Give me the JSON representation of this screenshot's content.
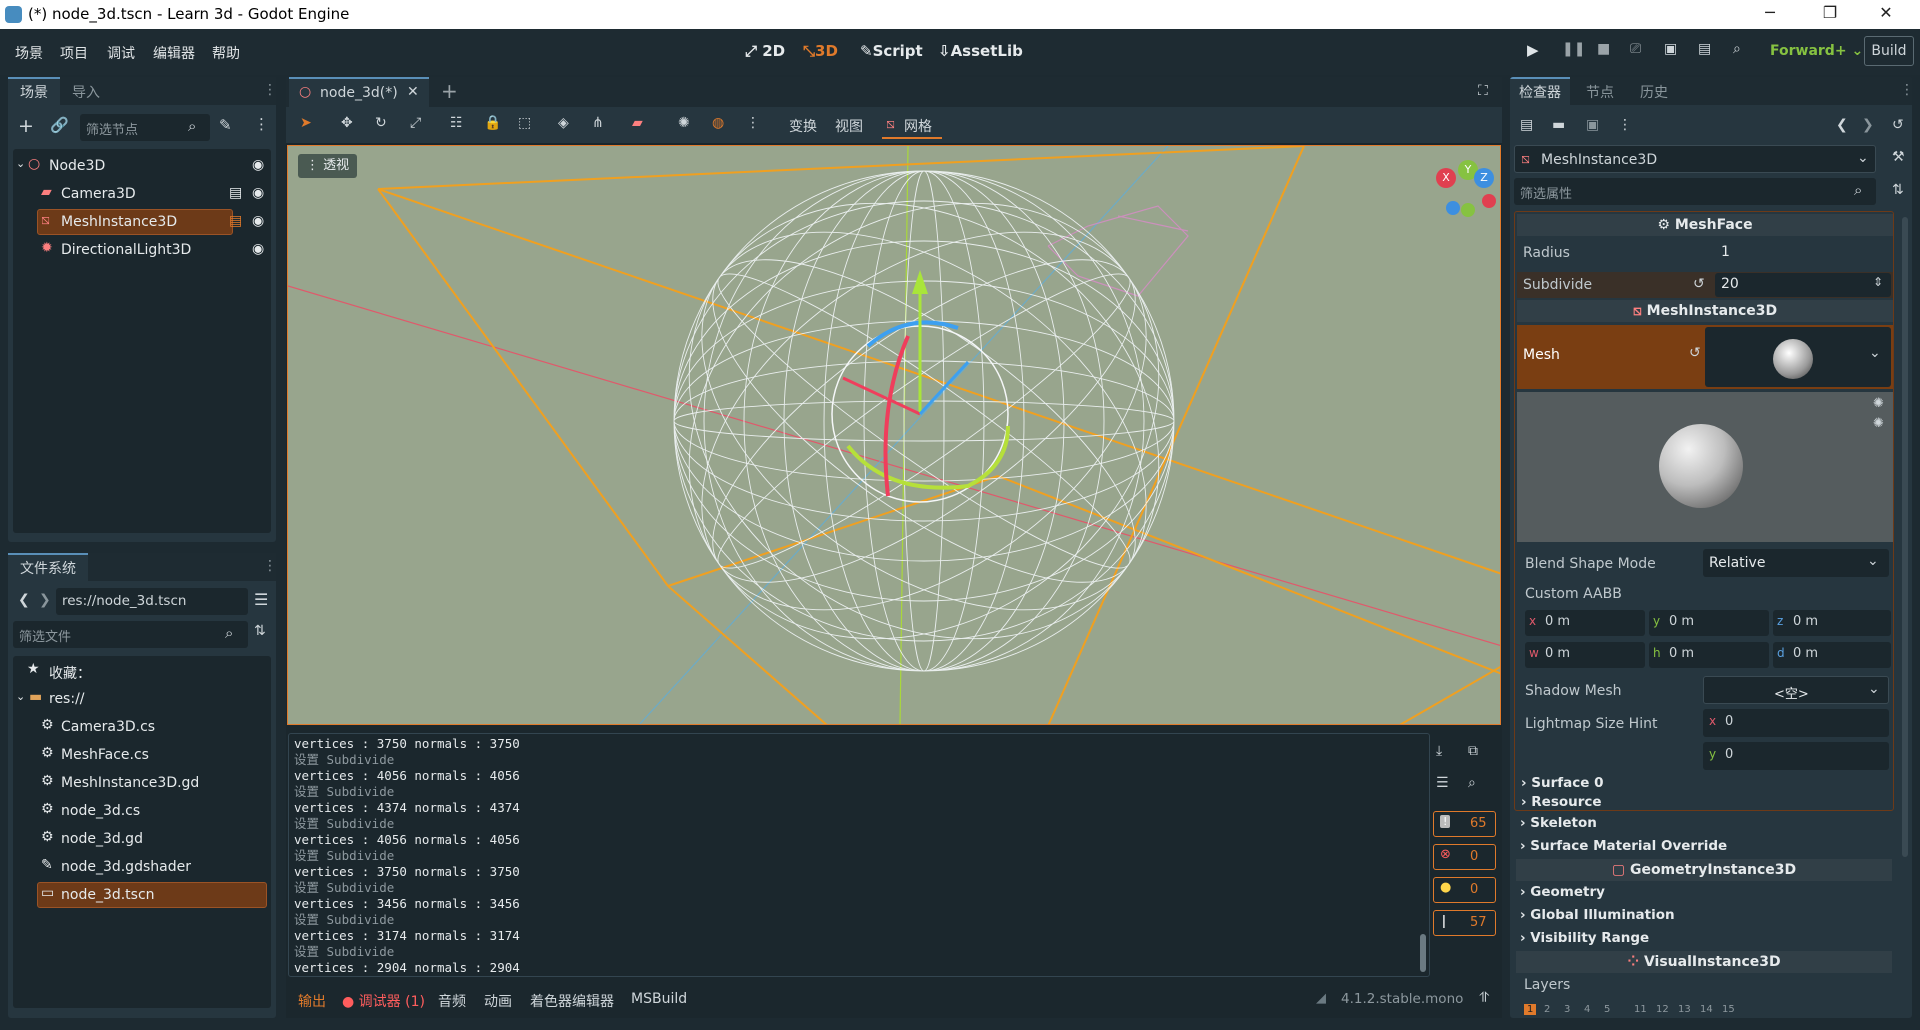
{
  "window": {
    "title": "(*) node_3d.tscn - Learn 3d - Godot Engine",
    "min": "─",
    "max": "❐",
    "close": "✕"
  },
  "menu": [
    "场景",
    "项目",
    "调试",
    "编辑器",
    "帮助"
  ],
  "workspaces": {
    "d2": "2D",
    "d3": "3D",
    "script": "Script",
    "assetlib": "AssetLib"
  },
  "run": {
    "renderer": "Forward+",
    "build": "Build"
  },
  "scene_dock": {
    "tab1": "场景",
    "tab2": "导入",
    "filter_placeholder": "筛选节点",
    "nodes": [
      {
        "name": "Node3D",
        "icon": "node3d-icon"
      },
      {
        "name": "Camera3D",
        "icon": "camera-icon"
      },
      {
        "name": "MeshInstance3D",
        "icon": "mesh-icon"
      },
      {
        "name": "DirectionalLight3D",
        "icon": "light-icon"
      }
    ]
  },
  "fs_dock": {
    "title": "文件系统",
    "path": "res://node_3d.tscn",
    "filter_placeholder": "筛选文件",
    "fav": "收藏：",
    "root": "res://",
    "files": [
      "Camera3D.cs",
      "MeshFace.cs",
      "MeshInstance3D.gd",
      "node_3d.cs",
      "node_3d.gd",
      "node_3d.gdshader",
      "node_3d.tscn"
    ]
  },
  "editor": {
    "tab": "node_3d(*)",
    "toolbar": {
      "transform": "变换",
      "view": "视图",
      "mesh": "网格"
    },
    "viewport_label": "透视",
    "gizmo": {
      "x": "X",
      "y": "Y",
      "z": "Z"
    }
  },
  "output": {
    "lines": [
      "vertices : 3750 normals : 3750",
      "设置 Subdivide",
      "vertices : 4056 normals : 4056",
      "设置 Subdivide",
      "vertices : 4374 normals : 4374",
      "设置 Subdivide",
      "vertices : 4056 normals : 4056",
      "设置 Subdivide",
      "vertices : 3750 normals : 3750",
      "设置 Subdivide",
      "vertices : 3456 normals : 3456",
      "设置 Subdivide",
      "vertices : 3174 normals : 3174",
      "设置 Subdivide",
      "vertices : 2904 normals : 2904"
    ],
    "counts": {
      "messages": "65",
      "errors": "0",
      "warnings": "0",
      "info": "57"
    }
  },
  "bottom_tabs": [
    "输出",
    "调试器 (1)",
    "音频",
    "动画",
    "着色器编辑器",
    "MSBuild"
  ],
  "version": "4.1.2.stable.mono",
  "inspector": {
    "tab1": "检查器",
    "tab2": "节点",
    "tab3": "历史",
    "object": "MeshInstance3D",
    "filter_placeholder": "筛选属性",
    "sec_meshface": "MeshFace",
    "radius_label": "Radius",
    "radius": "1",
    "subdivide_label": "Subdivide",
    "subdivide": "20",
    "sec_mi": "MeshInstance3D",
    "mesh_label": "Mesh",
    "blend_label": "Blend Shape Mode",
    "blend": "Relative",
    "aabb_label": "Custom AABB",
    "aabb": [
      {
        "k": "x",
        "v": "0 m"
      },
      {
        "k": "y",
        "v": "0 m"
      },
      {
        "k": "z",
        "v": "0 m"
      },
      {
        "k": "w",
        "v": "0 m"
      },
      {
        "k": "h",
        "v": "0 m"
      },
      {
        "k": "d",
        "v": "0 m"
      }
    ],
    "shadow_label": "Shadow Mesh",
    "shadow": "<空>",
    "lightmap_label": "Lightmap Size Hint",
    "lm_x": "0",
    "lm_y": "0",
    "surface0": "Surface 0",
    "resource": "Resource",
    "skeleton": "Skeleton",
    "smo": "Surface Material Override",
    "sec_geo": "GeometryInstance3D",
    "geometry": "Geometry",
    "gi": "Global Illumination",
    "vis": "Visibility Range",
    "sec_vis": "VisualInstance3D",
    "layers": "Layers",
    "layer_nums": [
      "1",
      "2",
      "3",
      "4",
      "5",
      "11",
      "12",
      "13",
      "14",
      "15"
    ]
  },
  "colors": {
    "accent": "#e07a2b",
    "selected": "#6d3a18",
    "bg": "#1d2a31",
    "panel": "#26363f",
    "viewport": "#98a58d"
  }
}
